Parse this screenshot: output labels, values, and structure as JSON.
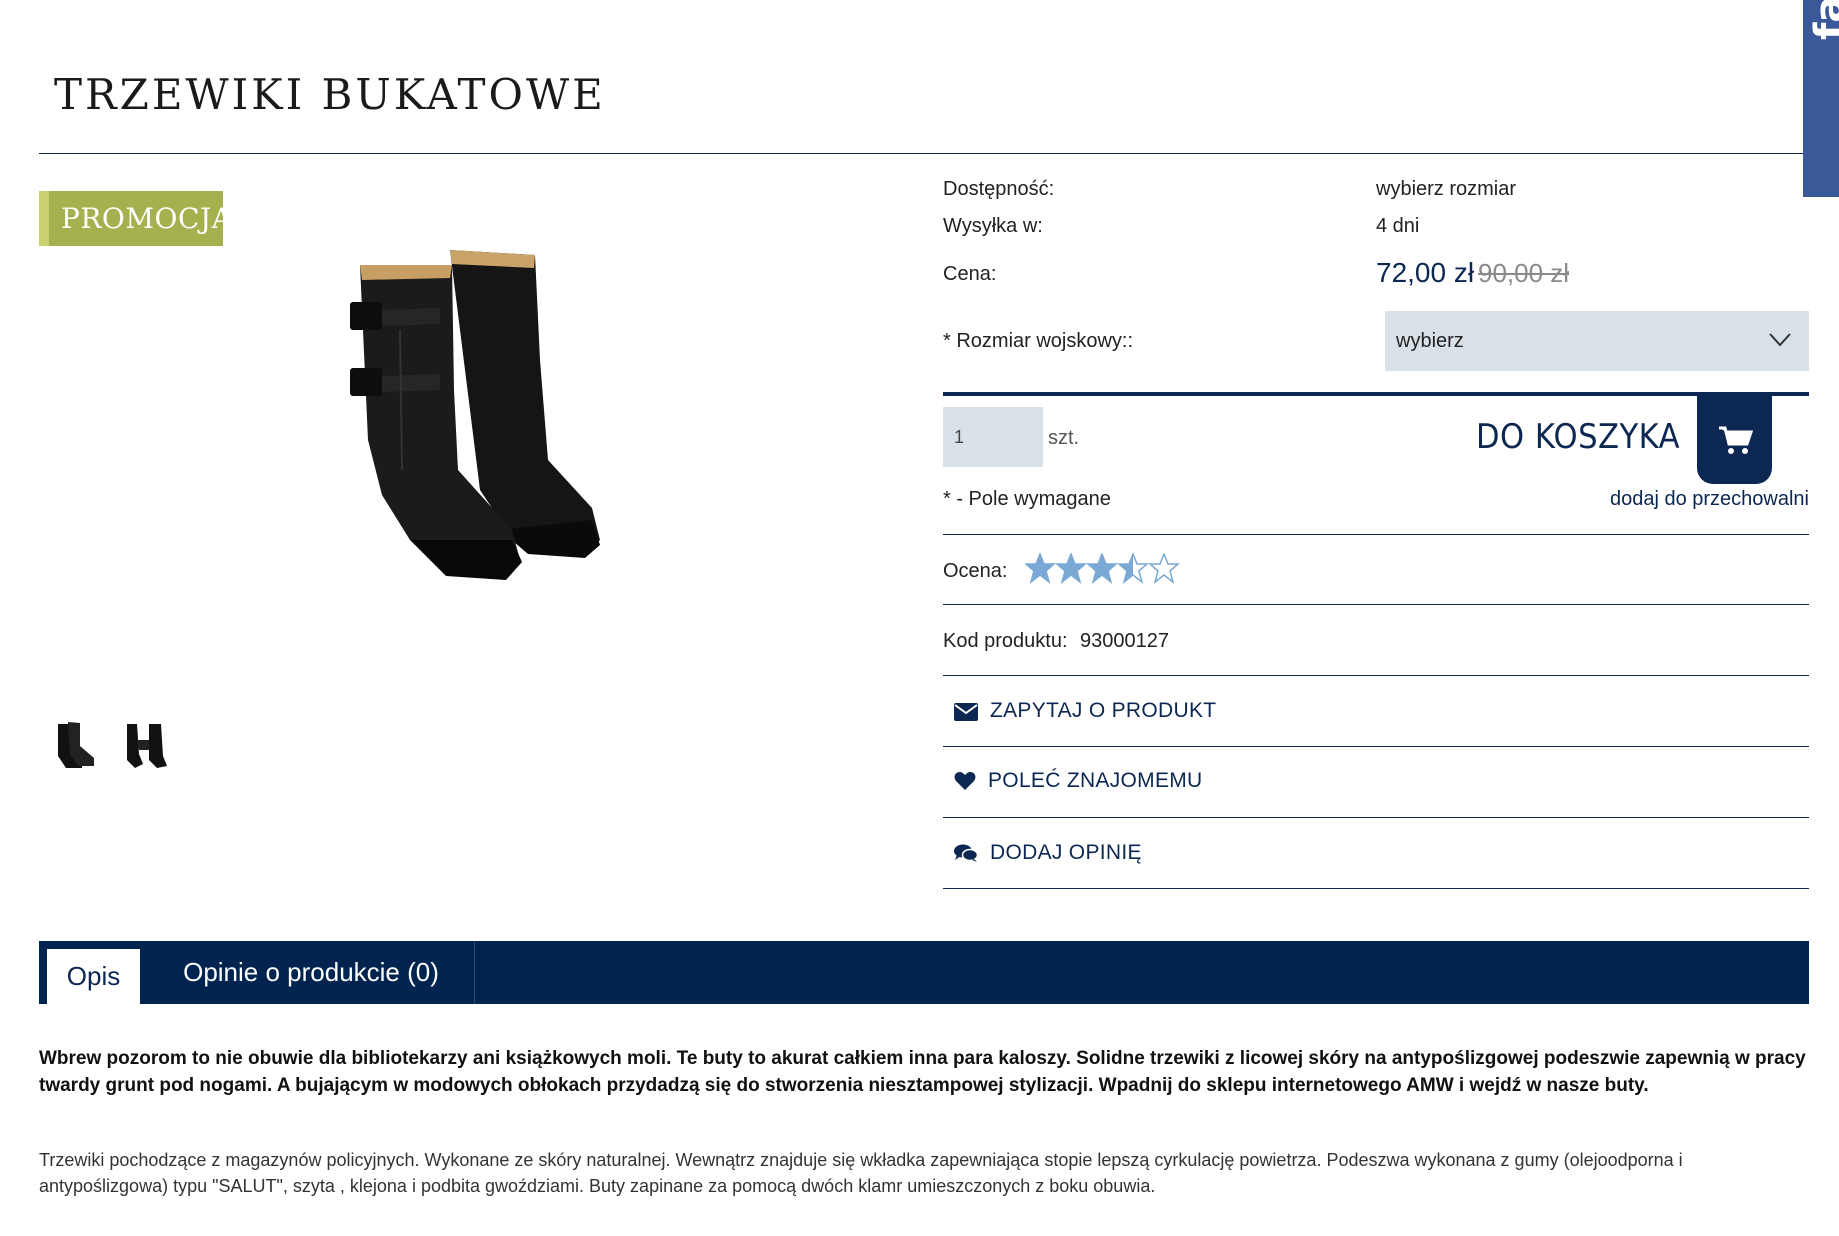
{
  "product": {
    "title": "TRZEWIKI BUKATOWE",
    "badge": "PROMOCJA"
  },
  "social": {
    "fb_label": "facebook"
  },
  "info": {
    "availability_label": "Dostępność:",
    "availability_value": "wybierz rozmiar",
    "shipping_label": "Wysyłka w:",
    "shipping_value": "4 dni",
    "price_label": "Cena:",
    "price_current": "72,00 zł",
    "price_old": "90,00 zł",
    "size_label": "* Rozmiar wojskowy::",
    "size_selected": "wybierz"
  },
  "cart": {
    "quantity": "1",
    "unit": "szt.",
    "add_label": "DO KOSZYKA",
    "required_note": "* - Pole wymagane",
    "storage_link": "dodaj do przechowalni"
  },
  "rating": {
    "label": "Ocena:",
    "value": 3.5,
    "max": 5,
    "color": "#7aa9d6"
  },
  "code": {
    "label": "Kod produktu:",
    "value": "93000127"
  },
  "actions": {
    "ask": "ZAPYTAJ O PRODUKT",
    "recommend": "POLEĆ ZNAJOMEMU",
    "review": "DODAJ OPINIĘ"
  },
  "tabs": {
    "opis": "Opis",
    "opinie": "Opinie o produkcie (0)"
  },
  "description": {
    "bold": "Wbrew pozorom to nie obuwie dla bibliotekarzy ani książkowych moli. Te buty to akurat całkiem inna para kaloszy. Solidne trzewiki z licowej skóry na antypoślizgowej podeszwie zapewnią w pracy twardy grunt pod nogami. A bujającym w modowych obłokach przydadzą się do stworzenia niesztampowej stylizacji. Wpadnij do sklepu internetowego AMW i wejdź w nasze buty.",
    "text": "Trzewiki pochodzące z magazynów policyjnych. Wykonane ze skóry naturalnej. Wewnątrz znajduje się wkładka zapewniająca stopie lepszą cyrkulację powietrza. Podeszwa wykonana z gumy (olejoodporna i antypoślizgowa) typu \"SALUT\", szyta , klejona i podbita gwoździami. Buty zapinane za pomocą dwóch klamr umieszczonych z boku obuwia."
  },
  "colors": {
    "navy": "#0b2752",
    "tab_bar": "#00244f",
    "promo": "#a5b04e",
    "input_bg": "#d8e0e8",
    "facebook": "#3b5998"
  }
}
